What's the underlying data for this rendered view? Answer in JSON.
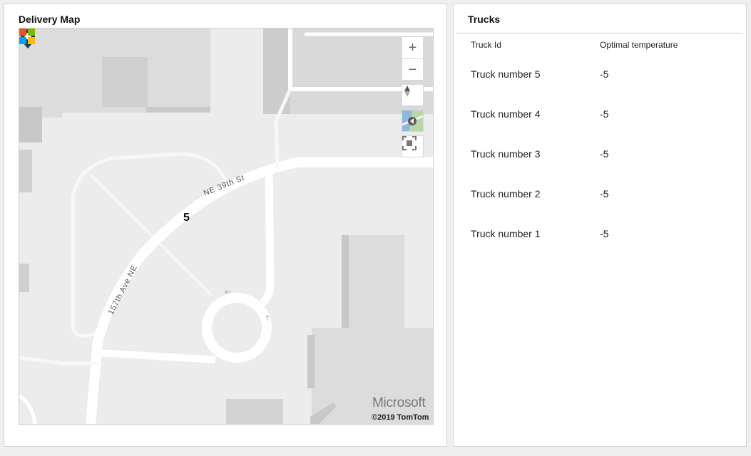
{
  "map_panel": {
    "title": "Delivery Map",
    "streets": [
      "NE 39th St",
      "157th Ave NE"
    ],
    "marker": {
      "label": "5",
      "icon": "map-pin-icon",
      "color": "#1f3f5c"
    },
    "controls": {
      "zoom_in": "+",
      "zoom_out": "−",
      "compass_icon": "compass-icon",
      "style_icon": "map-style-icon",
      "fullscreen_icon": "fullscreen-icon"
    },
    "branding": "Microsoft",
    "copyright": "©2019 TomTom"
  },
  "trucks_panel": {
    "title": "Trucks",
    "columns": [
      "Truck Id",
      "Optimal temperature"
    ],
    "rows": [
      {
        "id": "Truck number 5",
        "temp": "-5"
      },
      {
        "id": "Truck number 4",
        "temp": "-5"
      },
      {
        "id": "Truck number 3",
        "temp": "-5"
      },
      {
        "id": "Truck number 2",
        "temp": "-5"
      },
      {
        "id": "Truck number 1",
        "temp": "-5"
      }
    ]
  }
}
